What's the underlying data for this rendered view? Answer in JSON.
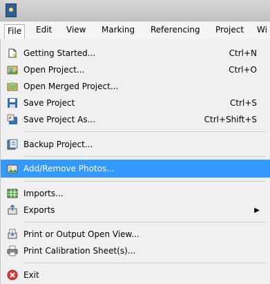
{
  "menubar": {
    "items": [
      "File",
      "Edit",
      "View",
      "Marking",
      "Referencing",
      "Project",
      "Wi"
    ]
  },
  "file_menu": {
    "items": [
      {
        "label": "Getting Started...",
        "shortcut": "Ctrl+N",
        "icon": "getting-started-icon"
      },
      {
        "label": "Open Project...",
        "shortcut": "Ctrl+O",
        "icon": "open-project-icon"
      },
      {
        "label": "Open Merged Project...",
        "shortcut": "",
        "icon": "open-merged-project-icon"
      },
      {
        "label": "Save Project",
        "shortcut": "Ctrl+S",
        "icon": "save-icon"
      },
      {
        "label": "Save Project As...",
        "shortcut": "Ctrl+Shift+S",
        "icon": "save-as-icon"
      },
      {
        "label": "Backup Project...",
        "shortcut": "",
        "icon": "backup-icon"
      },
      {
        "label": "Add/Remove Photos...",
        "shortcut": "",
        "icon": "photos-icon",
        "highlighted": true
      },
      {
        "label": "Imports...",
        "shortcut": "",
        "icon": "imports-icon"
      },
      {
        "label": "Exports",
        "shortcut": "",
        "icon": "exports-icon",
        "submenu": true
      },
      {
        "label": "Print or Output Open View...",
        "shortcut": "",
        "icon": "print-view-icon"
      },
      {
        "label": "Print Calibration Sheet(s)...",
        "shortcut": "",
        "icon": "printer-icon"
      },
      {
        "label": "Exit",
        "shortcut": "",
        "icon": "exit-icon"
      }
    ]
  },
  "colors": {
    "highlight": "#3399ff",
    "menu_background": "#f0f0f0"
  }
}
